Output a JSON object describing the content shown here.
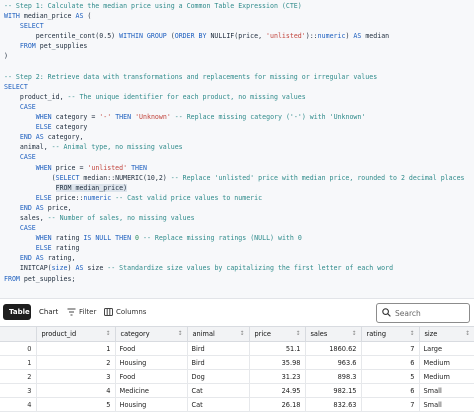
{
  "code_lines": [
    [
      {
        "c": "cm",
        "t": "-- Step 1: Calculate the median price using a Common Table Expression (CTE)"
      }
    ],
    [
      {
        "c": "kw",
        "t": "WITH"
      },
      {
        "c": "",
        "t": " median_price "
      },
      {
        "c": "kw",
        "t": "AS"
      },
      {
        "c": "",
        "t": " ("
      }
    ],
    [
      {
        "c": "",
        "t": "    "
      },
      {
        "c": "kw",
        "t": "SELECT"
      }
    ],
    [
      {
        "c": "",
        "t": "        percentile_cont(0.5) "
      },
      {
        "c": "kw",
        "t": "WITHIN GROUP"
      },
      {
        "c": "",
        "t": " ("
      },
      {
        "c": "kw",
        "t": "ORDER BY"
      },
      {
        "c": "",
        "t": " NULLIF(price, "
      },
      {
        "c": "str",
        "t": "'unlisted'"
      },
      {
        "c": "",
        "t": ")::"
      },
      {
        "c": "kw",
        "t": "numeric"
      },
      {
        "c": "",
        "t": ") "
      },
      {
        "c": "kw",
        "t": "AS"
      },
      {
        "c": "",
        "t": " median"
      }
    ],
    [
      {
        "c": "",
        "t": "    "
      },
      {
        "c": "kw",
        "t": "FROM"
      },
      {
        "c": "",
        "t": " pet_supplies"
      }
    ],
    [
      {
        "c": "",
        "t": ")"
      }
    ],
    [
      {
        "c": "",
        "t": ""
      }
    ],
    [
      {
        "c": "cm",
        "t": "-- Step 2: Retrieve data with transformations and replacements for missing or irregular values"
      }
    ],
    [
      {
        "c": "kw",
        "t": "SELECT"
      }
    ],
    [
      {
        "c": "",
        "t": "    product_id, "
      },
      {
        "c": "cm",
        "t": "-- The unique identifier for each product, no missing values"
      }
    ],
    [
      {
        "c": "",
        "t": "    "
      },
      {
        "c": "kw",
        "t": "CASE"
      }
    ],
    [
      {
        "c": "",
        "t": "        "
      },
      {
        "c": "kw",
        "t": "WHEN"
      },
      {
        "c": "",
        "t": " category = "
      },
      {
        "c": "str",
        "t": "'-'"
      },
      {
        "c": "",
        "t": " "
      },
      {
        "c": "kw",
        "t": "THEN"
      },
      {
        "c": "",
        "t": " "
      },
      {
        "c": "str",
        "t": "'Unknown'"
      },
      {
        "c": "",
        "t": " "
      },
      {
        "c": "cm",
        "t": "-- Replace missing category ('-') with 'Unknown'"
      }
    ],
    [
      {
        "c": "",
        "t": "        "
      },
      {
        "c": "kw",
        "t": "ELSE"
      },
      {
        "c": "",
        "t": " category"
      }
    ],
    [
      {
        "c": "",
        "t": "    "
      },
      {
        "c": "kw",
        "t": "END AS"
      },
      {
        "c": "",
        "t": " category,"
      }
    ],
    [
      {
        "c": "",
        "t": "    animal, "
      },
      {
        "c": "cm",
        "t": "-- Animal type, no missing values"
      }
    ],
    [
      {
        "c": "",
        "t": "    "
      },
      {
        "c": "kw",
        "t": "CASE"
      }
    ],
    [
      {
        "c": "",
        "t": "        "
      },
      {
        "c": "kw",
        "t": "WHEN"
      },
      {
        "c": "",
        "t": " price = "
      },
      {
        "c": "str",
        "t": "'unlisted'"
      },
      {
        "c": "",
        "t": " "
      },
      {
        "c": "kw",
        "t": "THEN"
      }
    ],
    [
      {
        "c": "",
        "t": "            ("
      },
      {
        "c": "kw",
        "t": "SELECT"
      },
      {
        "c": "",
        "t": " median::NUMERIC(10,2) "
      },
      {
        "c": "cm",
        "t": "-- Replace 'unlisted' price with median price, rounded to 2 decimal places"
      }
    ],
    [
      {
        "c": "",
        "t": "             "
      },
      {
        "c": "hl",
        "t": "FROM median_price)"
      }
    ],
    [
      {
        "c": "",
        "t": "        "
      },
      {
        "c": "kw",
        "t": "ELSE"
      },
      {
        "c": "",
        "t": " price::"
      },
      {
        "c": "kw",
        "t": "numeric"
      },
      {
        "c": "",
        "t": " "
      },
      {
        "c": "cm",
        "t": "-- Cast valid price values to numeric"
      }
    ],
    [
      {
        "c": "",
        "t": "    "
      },
      {
        "c": "kw",
        "t": "END AS"
      },
      {
        "c": "",
        "t": " price,"
      }
    ],
    [
      {
        "c": "",
        "t": "    sales, "
      },
      {
        "c": "cm",
        "t": "-- Number of sales, no missing values"
      }
    ],
    [
      {
        "c": "",
        "t": "    "
      },
      {
        "c": "kw",
        "t": "CASE"
      }
    ],
    [
      {
        "c": "",
        "t": "        "
      },
      {
        "c": "kw",
        "t": "WHEN"
      },
      {
        "c": "",
        "t": " rating "
      },
      {
        "c": "kw",
        "t": "IS NULL THEN"
      },
      {
        "c": "",
        "t": " "
      },
      {
        "c": "num",
        "t": "0"
      },
      {
        "c": "",
        "t": " "
      },
      {
        "c": "cm",
        "t": "-- Replace missing ratings (NULL) with 0"
      }
    ],
    [
      {
        "c": "",
        "t": "        "
      },
      {
        "c": "kw",
        "t": "ELSE"
      },
      {
        "c": "",
        "t": " rating"
      }
    ],
    [
      {
        "c": "",
        "t": "    "
      },
      {
        "c": "kw",
        "t": "END AS"
      },
      {
        "c": "",
        "t": " rating,"
      }
    ],
    [
      {
        "c": "",
        "t": "    INITCAP("
      },
      {
        "c": "kw",
        "t": "size"
      },
      {
        "c": "",
        "t": ") "
      },
      {
        "c": "kw",
        "t": "AS"
      },
      {
        "c": "",
        "t": " size "
      },
      {
        "c": "cm",
        "t": "-- Standardize size values by capitalizing the first letter of each word"
      }
    ],
    [
      {
        "c": "kw",
        "t": "FROM"
      },
      {
        "c": "",
        "t": " pet_supplies;"
      }
    ]
  ],
  "toolbar": {
    "tab_table": "Table",
    "tab_chart": "Chart",
    "filter_label": "Filter",
    "columns_label": "Columns",
    "search_placeholder": "Search"
  },
  "table": {
    "headers": [
      "",
      "product_id",
      "category",
      "animal",
      "price",
      "sales",
      "rating",
      "size"
    ],
    "rows": [
      [
        "0",
        "1",
        "Food",
        "Bird",
        "51.1",
        "1860.62",
        "7",
        "Large"
      ],
      [
        "1",
        "2",
        "Housing",
        "Bird",
        "35.98",
        "963.6",
        "6",
        "Medium"
      ],
      [
        "2",
        "3",
        "Food",
        "Dog",
        "31.23",
        "898.3",
        "5",
        "Medium"
      ],
      [
        "3",
        "4",
        "Medicine",
        "Cat",
        "24.95",
        "982.15",
        "6",
        "Small"
      ],
      [
        "4",
        "5",
        "Housing",
        "Cat",
        "26.18",
        "832.63",
        "7",
        "Small"
      ]
    ]
  }
}
